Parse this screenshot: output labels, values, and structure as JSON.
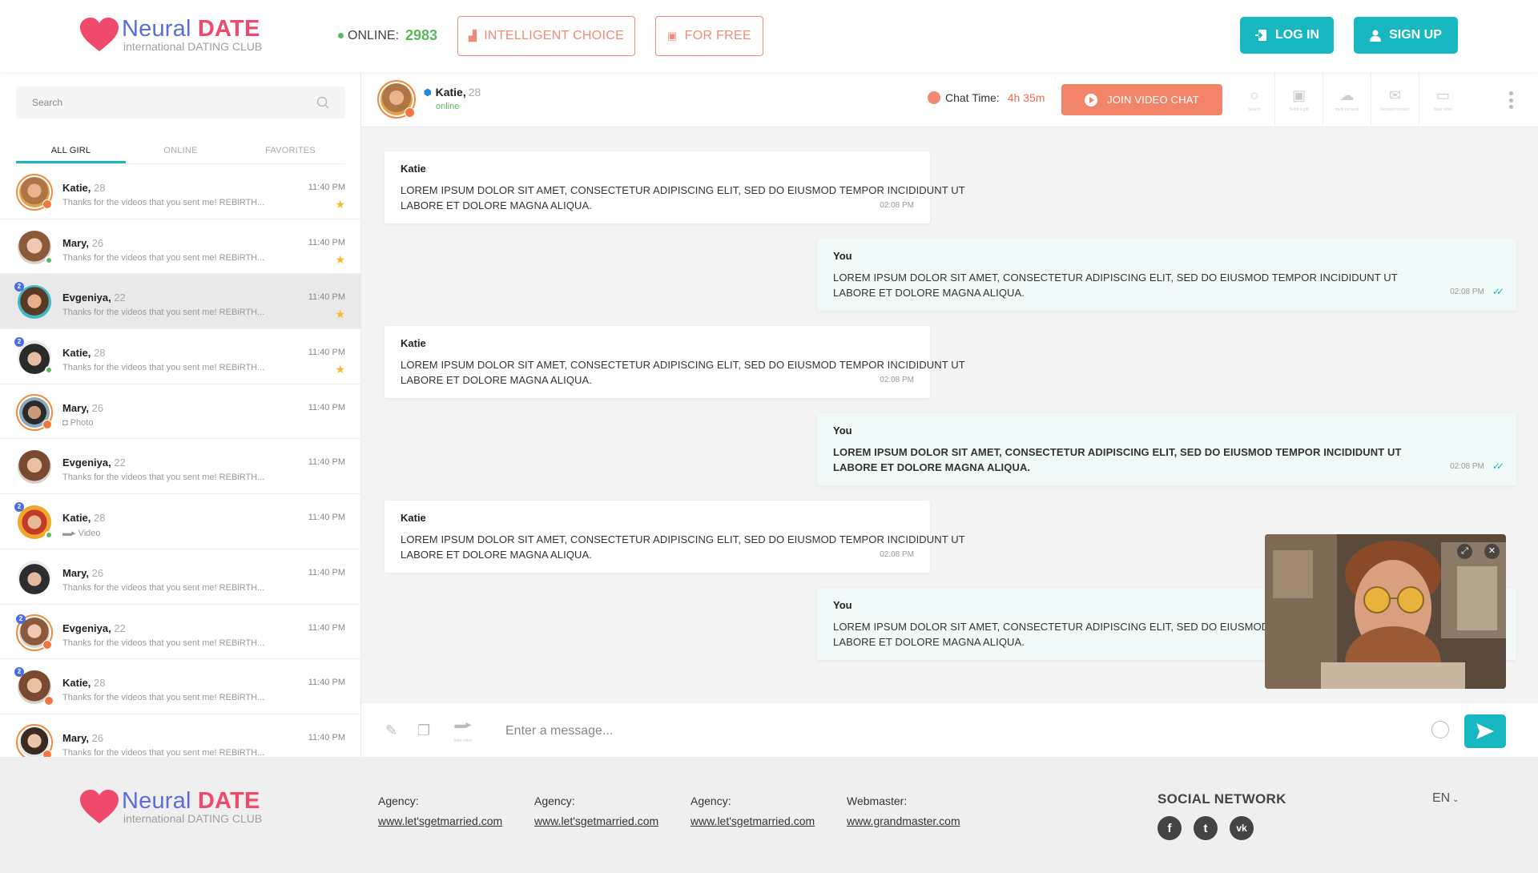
{
  "header": {
    "brand_main": "Neural",
    "brand_bold": "DATE",
    "tagline": "international DATING CLUB",
    "online_label": "ONLINE:",
    "online_count": "2983",
    "intelligent_choice": "INTELLIGENT CHOICE",
    "for_free": "FOR FREE",
    "login": "LOG IN",
    "signup": "SIGN UP"
  },
  "sidebar": {
    "search_placeholder": "Search",
    "tabs": [
      "ALL GIRL",
      "ONLINE",
      "FAVORITES"
    ],
    "items": [
      {
        "name": "Katie,",
        "age": "28",
        "msg": "Thanks for the videos that you sent me! REBiRTH...",
        "time": "11:40 PM",
        "star": "★"
      },
      {
        "name": "Mary,",
        "age": "26",
        "msg": "Thanks for the videos that you sent me! REBiRTH...",
        "time": "11:40 PM",
        "star": "★"
      },
      {
        "name": "Evgeniya,",
        "age": "22",
        "msg": "Thanks for the videos that you sent me! REBiRTH...",
        "time": "11:40 PM",
        "star": "★",
        "badge": "2"
      },
      {
        "name": "Katie,",
        "age": "28",
        "msg": "Thanks for the videos that you sent me! REBiRTH...",
        "time": "11:40 PM",
        "star": "★",
        "badge": "2"
      },
      {
        "name": "Mary,",
        "age": "26",
        "msg": "Photo",
        "time": "11:40 PM"
      },
      {
        "name": "Evgeniya,",
        "age": "22",
        "msg": "Thanks for the videos that you sent me! REBiRTH...",
        "time": "11:40 PM"
      },
      {
        "name": "Katie,",
        "age": "28",
        "msg": "Video",
        "time": "11:40 PM",
        "badge": "2"
      },
      {
        "name": "Mary,",
        "age": "26",
        "msg": "Thanks for the videos that you sent me! REBiRTH...",
        "time": "11:40 PM"
      },
      {
        "name": "Evgeniya,",
        "age": "22",
        "msg": "Thanks for the videos that you sent me! REBiRTH...",
        "time": "11:40 PM",
        "badge": "2"
      },
      {
        "name": "Katie,",
        "age": "28",
        "msg": "Thanks for the videos that you sent me! REBiRTH...",
        "time": "11:40 PM",
        "badge": "2"
      },
      {
        "name": "Mary,",
        "age": "26",
        "msg": "Thanks for the videos that you sent me! REBiRTH...",
        "time": "11:40 PM"
      }
    ]
  },
  "chat": {
    "contact_name": "Katie,",
    "contact_age": "28",
    "contact_status": "online",
    "chat_time_label": "Chat Time:",
    "chat_time_value": "4h 35m",
    "join_video": "JOIN VIDEO CHAT",
    "tools": [
      "Search",
      "Send a gift",
      "multi-picsend",
      "Request contact",
      "Start video"
    ],
    "messages": [
      {
        "from": "Katie",
        "text": "Lorem ipsum dolor sit amet, consectetur adipiscing elit, sed do eiusmod tempor incididunt ut labore et dolore magna aliqua.",
        "time": "02:08 PM"
      },
      {
        "from": "You",
        "text": "Lorem ipsum dolor sit amet, consectetur adipiscing elit, sed do eiusmod tempor incididunt ut labore et dolore magna aliqua.",
        "time": "02:08 PM"
      },
      {
        "from": "Katie",
        "text": "Lorem ipsum dolor sit amet, consectetur adipiscing elit, sed do eiusmod tempor incididunt ut labore et dolore magna aliqua.",
        "time": "02:08 PM"
      },
      {
        "from": "You",
        "text": "Lorem ipsum dolor sit amet, consectetur adipiscing elit, sed do eiusmod tempor incididunt ut labore et dolore magna aliqua.",
        "time": "02:08 PM"
      },
      {
        "from": "Katie",
        "text": "Lorem ipsum dolor sit amet, consectetur adipiscing elit, sed do eiusmod tempor incididunt ut labore et dolore magna aliqua.",
        "time": "02:08 PM"
      },
      {
        "from": "You",
        "text": "Lorem ipsum dolor sit amet, consectetur adipiscing elit, sed do eiusmod tempor incididunt ut labore et dolore magna aliqua.",
        "time": ""
      }
    ],
    "composer_placeholder": "Enter a message...",
    "composer_tool_label": "Start video"
  },
  "footer": {
    "links": [
      {
        "k": "Agency:",
        "v": "www.let'sgetmarried.com"
      },
      {
        "k": "Agency:",
        "v": "www.let'sgetmarried.com"
      },
      {
        "k": "Agency:",
        "v": "www.let'sgetmarried.com"
      },
      {
        "k": "Webmaster:",
        "v": "www.grandmaster.com"
      }
    ],
    "social_title": "SOCIAL NETWORK",
    "language": "EN"
  },
  "colors": {
    "accent": "#17b8bf",
    "coral": "#f2846a",
    "brand_blue": "#5b6dd6",
    "brand_red": "#ef4a6b",
    "online": "#5cb85c"
  }
}
